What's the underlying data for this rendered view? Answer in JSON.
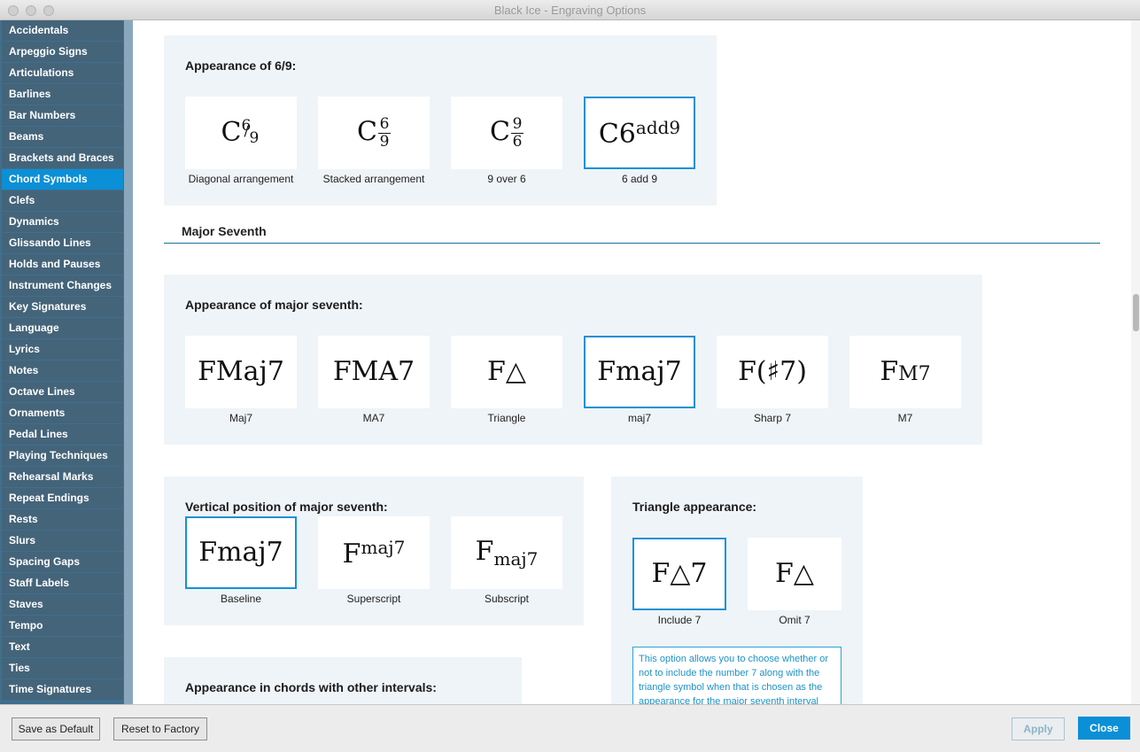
{
  "window": {
    "title": "Black Ice - Engraving Options"
  },
  "sidebar": {
    "items": [
      {
        "label": "Accidentals"
      },
      {
        "label": "Arpeggio Signs"
      },
      {
        "label": "Articulations"
      },
      {
        "label": "Barlines"
      },
      {
        "label": "Bar Numbers"
      },
      {
        "label": "Beams"
      },
      {
        "label": "Brackets and Braces"
      },
      {
        "label": "Chord Symbols"
      },
      {
        "label": "Clefs"
      },
      {
        "label": "Dynamics"
      },
      {
        "label": "Glissando Lines"
      },
      {
        "label": "Holds and Pauses"
      },
      {
        "label": "Instrument Changes"
      },
      {
        "label": "Key Signatures"
      },
      {
        "label": "Language"
      },
      {
        "label": "Lyrics"
      },
      {
        "label": "Notes"
      },
      {
        "label": "Octave Lines"
      },
      {
        "label": "Ornaments"
      },
      {
        "label": "Pedal Lines"
      },
      {
        "label": "Playing Techniques"
      },
      {
        "label": "Rehearsal Marks"
      },
      {
        "label": "Repeat Endings"
      },
      {
        "label": "Rests"
      },
      {
        "label": "Slurs"
      },
      {
        "label": "Spacing Gaps"
      },
      {
        "label": "Staff Labels"
      },
      {
        "label": "Staves"
      },
      {
        "label": "Tempo"
      },
      {
        "label": "Text"
      },
      {
        "label": "Ties"
      },
      {
        "label": "Time Signatures"
      }
    ],
    "selected": "Chord Symbols"
  },
  "six_nine": {
    "title": "Appearance of 6/9:",
    "options": [
      {
        "label": "Diagonal arrangement",
        "root": "C",
        "top": "6",
        "bottom": "9"
      },
      {
        "label": "Stacked arrangement",
        "root": "C",
        "top": "6",
        "bottom": "9"
      },
      {
        "label": "9 over 6",
        "root": "C",
        "top": "9",
        "bottom": "6"
      },
      {
        "label": "6 add 9",
        "root": "C6",
        "sup": "add9",
        "selected": true
      }
    ]
  },
  "major_seventh": {
    "section_title": "Major Seventh",
    "appearance": {
      "title": "Appearance of major seventh:",
      "options": [
        {
          "label": "Maj7",
          "glyph": "FMaj7"
        },
        {
          "label": "MA7",
          "glyph": "FMA7"
        },
        {
          "label": "Triangle",
          "glyph": "F△"
        },
        {
          "label": "maj7",
          "glyph": "Fmaj7",
          "selected": true
        },
        {
          "label": "Sharp 7",
          "glyph": "F(♯7)"
        },
        {
          "label": "M7",
          "glyph_root": "F",
          "glyph_small": "M7"
        }
      ]
    },
    "vertical": {
      "title": "Vertical position of major seventh:",
      "options": [
        {
          "label": "Baseline",
          "root": "F",
          "ext": "maj7",
          "selected": true
        },
        {
          "label": "Superscript",
          "root": "F",
          "ext": "maj7"
        },
        {
          "label": "Subscript",
          "root": "F",
          "ext": "maj7"
        }
      ]
    },
    "triangle": {
      "title": "Triangle appearance:",
      "options": [
        {
          "label": "Include 7",
          "glyph": "F△7",
          "selected": true
        },
        {
          "label": "Omit 7",
          "glyph": "F△"
        }
      ],
      "info": "This option allows you to choose whether or not to include the number 7 along with the triangle symbol when that is chosen as the appearance for the major seventh interval"
    },
    "other_intervals": {
      "title": "Appearance in chords with other intervals:"
    }
  },
  "footer": {
    "save_default": "Save as Default",
    "reset_factory": "Reset to Factory",
    "apply": "Apply",
    "close": "Close"
  },
  "colors": {
    "accent": "#0b8fd6",
    "sidebar": "#44647a",
    "panel": "#eff4f8"
  }
}
